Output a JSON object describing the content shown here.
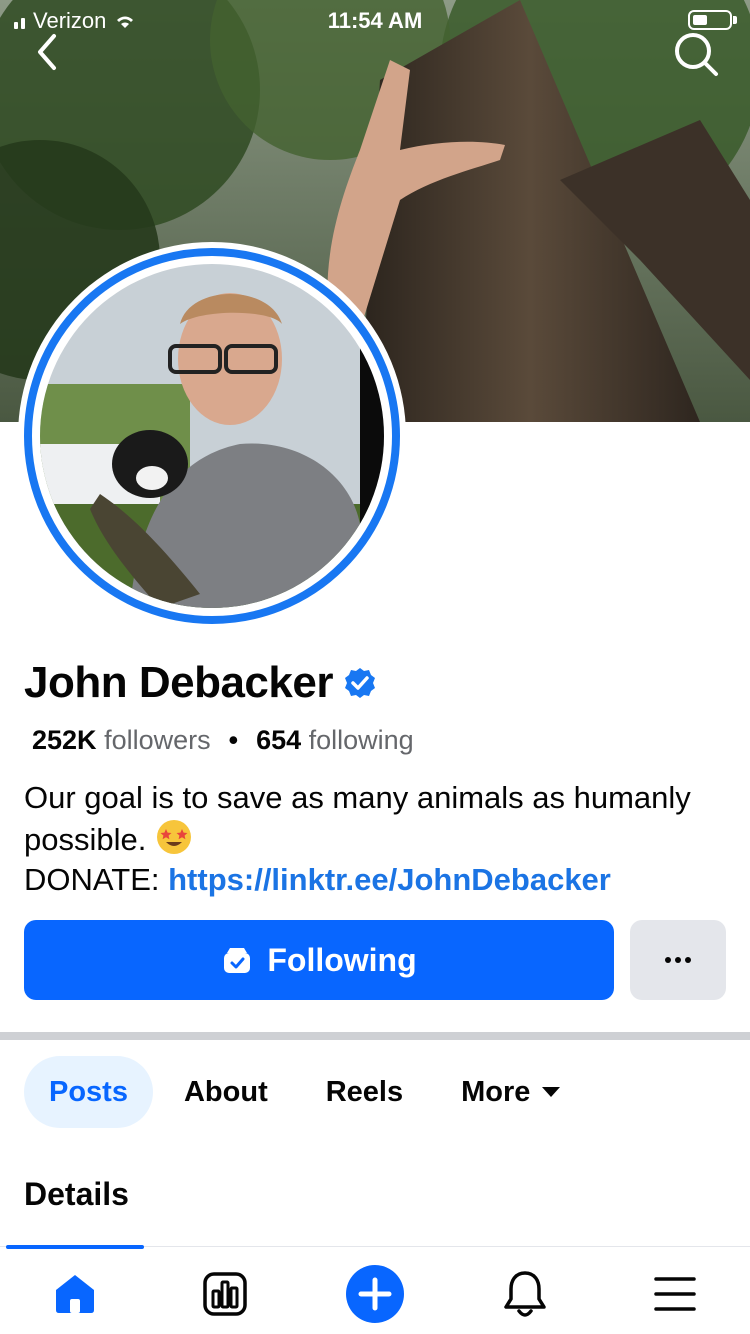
{
  "status_bar": {
    "carrier": "Verizon",
    "time": "11:54 AM"
  },
  "profile": {
    "name": "John Debacker",
    "verified": true,
    "followers_count": "252K",
    "followers_label": "followers",
    "following_count": "654",
    "following_label": "following",
    "bio_line1": "Our goal is to save as many animals as humanly possible.",
    "bio_donate_label": "DONATE:",
    "bio_link": "https://linktr.ee/JohnDebacker"
  },
  "actions": {
    "following_label": "Following",
    "more_label": "..."
  },
  "tabs": [
    {
      "label": "Posts",
      "active": true
    },
    {
      "label": "About",
      "active": false
    },
    {
      "label": "Reels",
      "active": false
    },
    {
      "label": "More",
      "active": false
    }
  ],
  "section": {
    "details_heading": "Details"
  },
  "bottom_nav": [
    {
      "icon": "home-icon",
      "active": true
    },
    {
      "icon": "dashboard-icon",
      "active": false
    },
    {
      "icon": "create-icon",
      "active": false
    },
    {
      "icon": "notifications-icon",
      "active": false
    },
    {
      "icon": "menu-icon",
      "active": false
    }
  ],
  "colors": {
    "brand_blue": "#0866ff",
    "link_blue": "#1b74e4",
    "tab_active_bg": "#e7f3ff"
  }
}
